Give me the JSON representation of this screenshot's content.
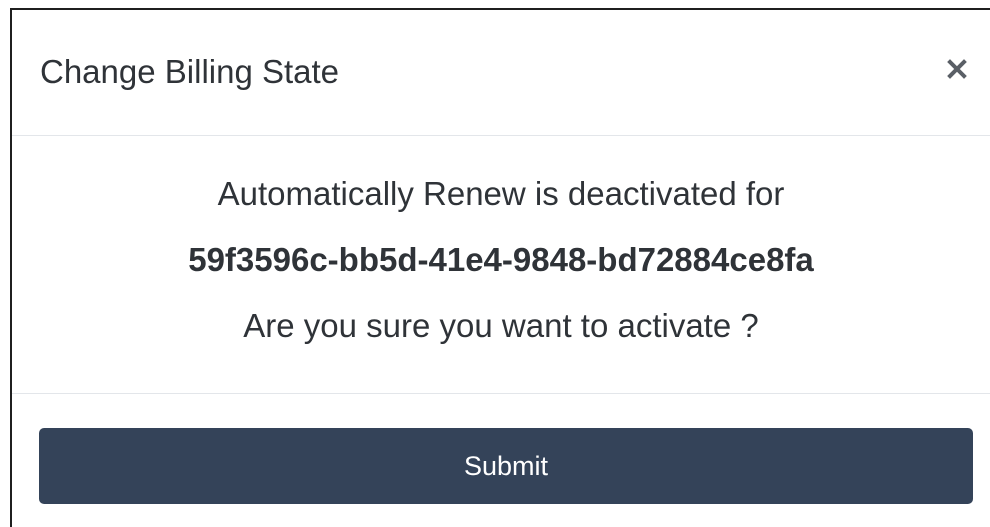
{
  "dialog": {
    "title": "Change Billing State",
    "close_icon": "close-icon"
  },
  "body": {
    "line1": "Automatically Renew is deactivated for",
    "subscription_id": "59f3596c-bb5d-41e4-9848-bd72884ce8fa",
    "line3": "Are you sure you want to activate  ?"
  },
  "footer": {
    "submit_label": "Submit"
  },
  "colors": {
    "submit_bg": "#344359",
    "text": "#2f3338",
    "divider": "#e3e6ea"
  }
}
